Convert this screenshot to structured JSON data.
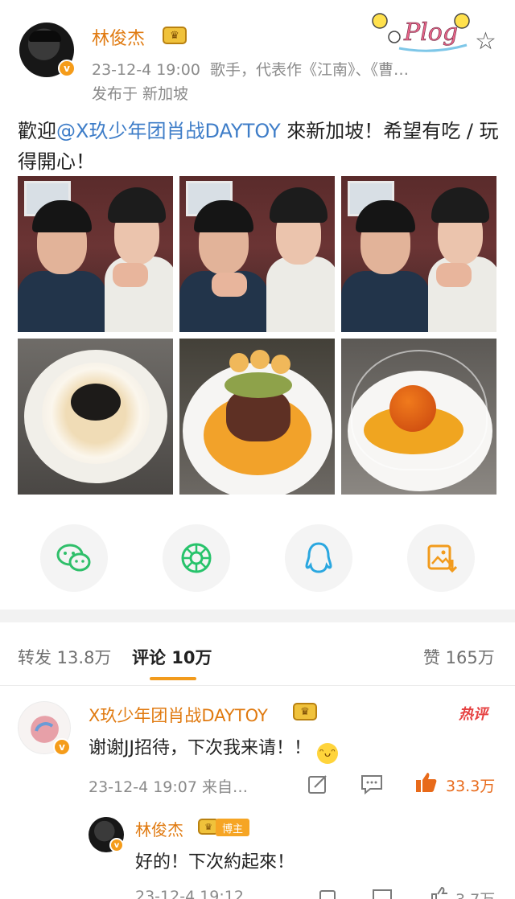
{
  "post": {
    "author": "林俊杰",
    "verified_badge": "v",
    "crown_icon": "vip-crown-icon",
    "time": "23-12-4 19:00",
    "bio": "歌手，代表作《江南》、《曹…",
    "location": "发布于 新加坡",
    "text_before": "歡迎",
    "mention": "@X玖少年团肖战DAYTOY",
    "text_after": " 來新加坡！希望有吃 / 玩得開心！",
    "sticker_text": "Plog",
    "accent_color": "#e07a10",
    "mention_color": "#3e7dc8"
  },
  "share": [
    {
      "name": "wechat",
      "icon": "wechat-icon",
      "color": "#2fbf6a"
    },
    {
      "name": "moments",
      "icon": "moments-icon",
      "color": "#27c36b"
    },
    {
      "name": "qq",
      "icon": "qq-icon",
      "color": "#2aa7e0"
    },
    {
      "name": "save-image",
      "icon": "save-image-icon",
      "color": "#f29b1d"
    }
  ],
  "tabs": {
    "repost": "转发 13.8万",
    "comments": "评论 10万",
    "likes": "赞 165万"
  },
  "comment": {
    "author": "X玖少年团肖战DAYTOY",
    "hot_label": "热评",
    "text": "谢谢JJ招待，下次我来请！！",
    "time": "23-12-4 19:07",
    "source": "来自…",
    "like_count": "33.3万"
  },
  "reply": {
    "author": "林俊杰",
    "badge": "博主",
    "text": "好的！下次約起來！",
    "time": "23-12-4 19:12",
    "like_count": "3.7万"
  }
}
